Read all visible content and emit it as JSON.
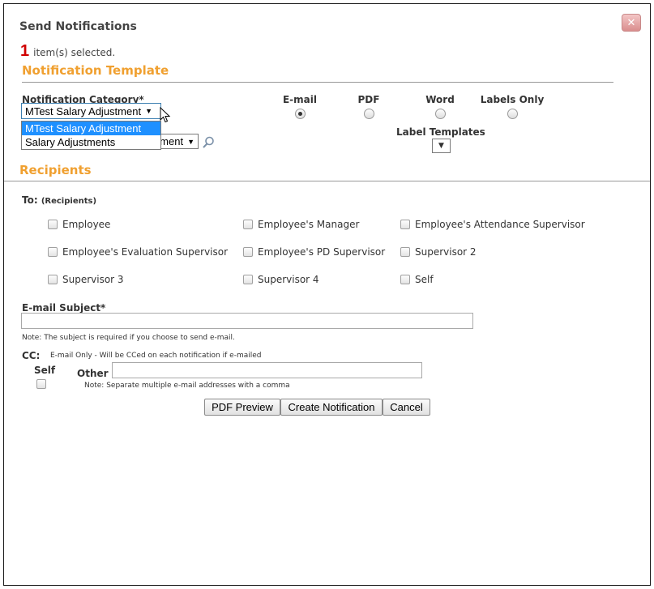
{
  "dialog": {
    "title": "Send Notifications",
    "close_icon": "close-x-icon",
    "selected_count": "1",
    "selected_text": "item(s) selected."
  },
  "template_section": {
    "heading": "Notification Template",
    "category_label": "Notification Category*",
    "category_value": "MTest Salary Adjustment",
    "category_options": [
      "MTest Salary Adjustment",
      "Salary Adjustments"
    ],
    "template_value_partial": "ment",
    "formats": [
      "E-mail",
      "PDF",
      "Word",
      "Labels Only"
    ],
    "selected_format": "E-mail",
    "label_templates_label": "Label Templates"
  },
  "recipients_section": {
    "heading": "Recipients",
    "to_label": "To:",
    "to_sub": "(Recipients)",
    "options": [
      "Employee",
      "Employee's Manager",
      "Employee's Attendance Supervisor",
      "Employee's Evaluation Supervisor",
      "Employee's PD Supervisor",
      "Supervisor 2",
      "Supervisor 3",
      "Supervisor 4",
      "Self"
    ]
  },
  "email": {
    "subject_label": "E-mail Subject*",
    "subject_value": "",
    "subject_note": "Note: The subject is required if you choose to send e-mail.",
    "cc_label": "CC:",
    "cc_note": "E-mail Only - Will be CCed on each notification if e-mailed",
    "self_label": "Self",
    "other_label": "Other",
    "other_value": "",
    "other_note": "Note: Separate multiple e-mail addresses with a comma"
  },
  "buttons": {
    "pdf_preview": "PDF Preview",
    "create": "Create Notification",
    "cancel": "Cancel"
  },
  "colors": {
    "heading": "#f0a030",
    "count": "#d00000",
    "dropdown_highlight": "#1e90ff"
  }
}
